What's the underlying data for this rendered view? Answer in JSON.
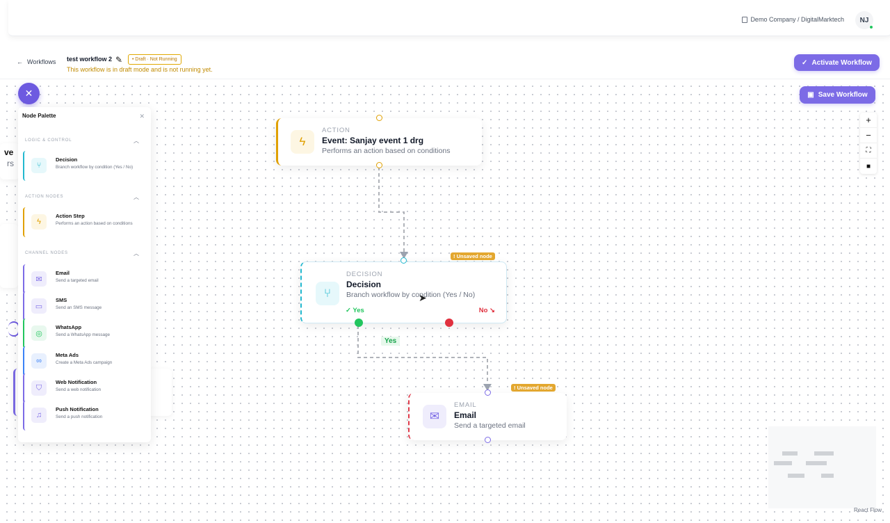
{
  "header": {
    "company": "Demo Company / DigitalMarktech",
    "avatar_initials": "NJ"
  },
  "workflow": {
    "back_label": "Workflows",
    "name": "test workflow 2",
    "status_badge": "• Draft · Not Running",
    "draft_message": "This workflow is in draft mode and is not running yet.",
    "activate_label": "Activate Workflow",
    "save_label": "Save Workflow"
  },
  "palette": {
    "title": "Node Palette",
    "sections": [
      {
        "title": "LOGIC & CONTROL",
        "items": [
          {
            "name": "Decision",
            "desc": "Branch workflow by condition (Yes / No)",
            "icon": "branch-icon",
            "color": "#22b8cf"
          }
        ]
      },
      {
        "title": "ACTION NODES",
        "items": [
          {
            "name": "Action Step",
            "desc": "Performs an action based on conditions",
            "icon": "lightning-icon",
            "color": "#e0a000"
          }
        ]
      },
      {
        "title": "CHANNEL NODES",
        "items": [
          {
            "name": "Email",
            "desc": "Send a targeted email",
            "icon": "mail-icon",
            "color": "#7c6be6"
          },
          {
            "name": "SMS",
            "desc": "Send an SMS message",
            "icon": "message-icon",
            "color": "#7c6be6"
          },
          {
            "name": "WhatsApp",
            "desc": "Send a WhatsApp message",
            "icon": "whatsapp-icon",
            "color": "#22c55e"
          },
          {
            "name": "Meta Ads",
            "desc": "Create a Meta Ads campaign",
            "icon": "meta-icon",
            "color": "#3b82f6"
          },
          {
            "name": "Web Notification",
            "desc": "Send a web notification",
            "icon": "shield-bell-icon",
            "color": "#7c6be6"
          },
          {
            "name": "Push Notification",
            "desc": "Send a push notification",
            "icon": "bell-icon",
            "color": "#7c6be6"
          }
        ]
      }
    ]
  },
  "nodes": {
    "action": {
      "type": "ACTION",
      "title": "Event: Sanjay event 1 drg",
      "desc": "Performs an action based on conditions"
    },
    "decision": {
      "type": "DECISION",
      "title": "Decision",
      "desc": "Branch workflow by condition (Yes / No)",
      "yes": "✓ Yes",
      "no": "No ↘",
      "unsaved": "! Unsaved node"
    },
    "email": {
      "type": "EMAIL",
      "title": "Email",
      "desc": "Send a targeted email",
      "unsaved": "! Unsaved node"
    }
  },
  "edge_labels": {
    "yes": "Yes"
  },
  "partial_text": {
    "a": "ve",
    "b": "rs"
  },
  "attribution": "React Flow",
  "colors": {
    "accent": "#7c6be6",
    "action": "#e0a000",
    "decision": "#22b8cf",
    "email": "#e03a4a",
    "yes": "#22c55e",
    "no": "#e0303e"
  }
}
